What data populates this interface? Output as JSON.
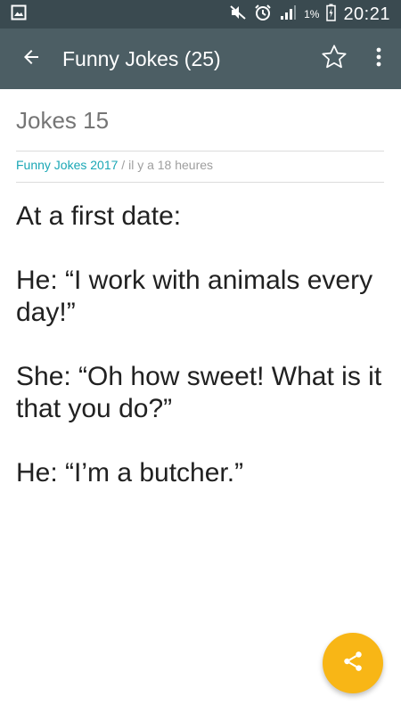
{
  "status_bar": {
    "battery_percent": "1%",
    "time": "20:21"
  },
  "app_bar": {
    "title": "Funny Jokes (25)"
  },
  "article": {
    "title": "Jokes 15",
    "source": "Funny Jokes 2017",
    "separator": " / ",
    "time_ago": "il y a 18 heures",
    "paragraphs": [
      "At a first date:",
      "He: “I work with animals every day!”",
      "She: “Oh how sweet! What is it that you do?”",
      "He: “I’m a butcher.”"
    ]
  },
  "colors": {
    "status_bar": "#3a4a50",
    "app_bar": "#4c5e64",
    "accent_link": "#1aa7b5",
    "fab": "#f8b616"
  },
  "icons": {
    "status_left": "gallery-icon",
    "mute": "mute-icon",
    "alarm": "alarm-icon",
    "signal": "signal-icon",
    "battery": "battery-icon",
    "back": "back-arrow-icon",
    "favorite": "star-icon",
    "menu": "more-vert-icon",
    "share": "share-icon"
  }
}
